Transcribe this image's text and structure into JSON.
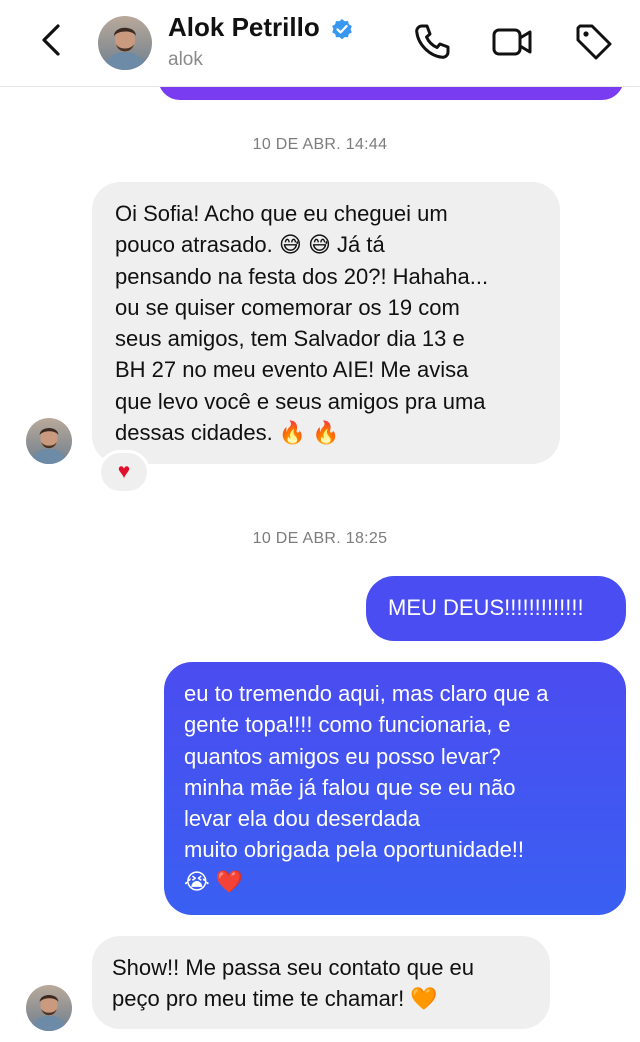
{
  "header": {
    "contact_name": "Alok Petrillo",
    "handle": "alok",
    "verified": true,
    "icons": [
      "back-chevron-icon",
      "avatar",
      "verified-badge-icon",
      "phone-icon",
      "video-camera-icon",
      "tag-icon"
    ]
  },
  "colors": {
    "incoming_bubble": "#efefef",
    "outgoing_gradient_top": "#7a3cf0",
    "outgoing_gradient_bottom": "#3a5df0",
    "verified_blue": "#3897f0",
    "timestamp_gray": "#7c7c7c"
  },
  "messages": [
    {
      "type": "timestamp",
      "text": "10 DE ABR. 14:44"
    },
    {
      "type": "incoming",
      "text": "Oi Sofia! Acho que eu cheguei um\npouco atrasado. 😅 😅  Já tá\npensando na festa dos 20?! Hahaha...\nou se quiser comemorar os 19 com\nseus amigos, tem Salvador dia 13 e\nBH 27 no meu evento AIE! Me avisa\nque levo você e seus amigos pra uma\ndessas cidades. 🔥 🔥",
      "reaction": "♥"
    },
    {
      "type": "timestamp",
      "text": "10 DE ABR. 18:25"
    },
    {
      "type": "outgoing",
      "text": "MEU DEUS!!!!!!!!!!!!!"
    },
    {
      "type": "outgoing",
      "text": "eu to tremendo aqui, mas claro que a\ngente topa!!!! como funcionaria, e\nquantos amigos eu posso levar?\nminha mãe já falou que se eu não\nlevar ela dou deserdada\nmuito obrigada pela oportunidade!!\n😭 ❤️"
    },
    {
      "type": "incoming",
      "text": "Show!! Me passa seu contato que eu\npeço pro meu time te chamar! 🧡"
    }
  ]
}
